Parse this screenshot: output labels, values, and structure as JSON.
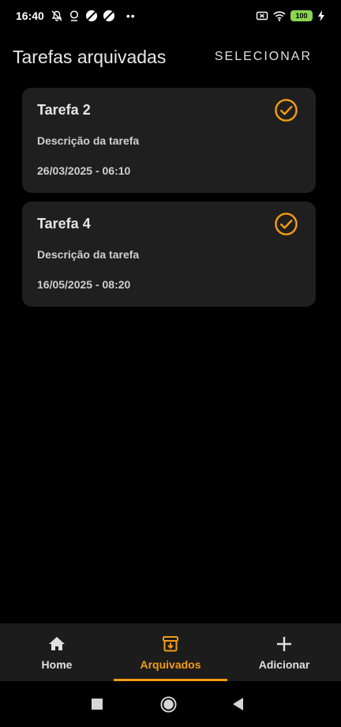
{
  "status_bar": {
    "time": "16:40",
    "battery": "100",
    "dots": "••"
  },
  "header": {
    "title": "Tarefas arquivadas",
    "select_label": "SELECIONAR"
  },
  "tasks": [
    {
      "title": "Tarefa 2",
      "description": "Descrição da tarefa",
      "datetime": "26/03/2025 - 06:10",
      "icon": "check-circle-icon"
    },
    {
      "title": "Tarefa 4",
      "description": "Descrição da tarefa",
      "datetime": "16/05/2025 - 08:20",
      "icon": "check-circle-icon"
    }
  ],
  "bottom_nav": {
    "items": [
      {
        "label": "Home",
        "icon": "home-icon",
        "active": false
      },
      {
        "label": "Arquivados",
        "icon": "archive-icon",
        "active": true
      },
      {
        "label": "Adicionar",
        "icon": "plus-icon",
        "active": false
      }
    ]
  },
  "colors": {
    "accent": "#f39c12",
    "card_background": "#1f1f1f",
    "background": "#000000"
  }
}
